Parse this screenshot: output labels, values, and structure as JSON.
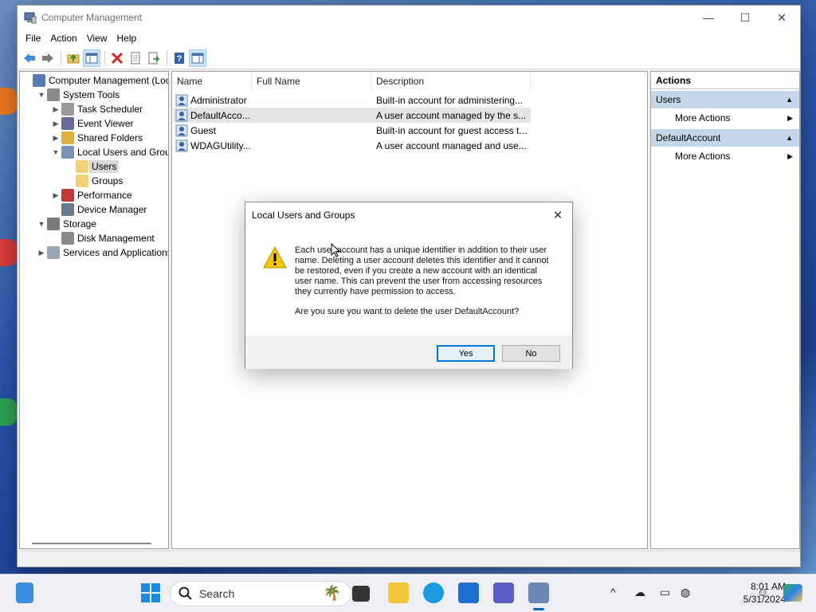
{
  "window": {
    "title": "Computer Management",
    "controls": {
      "minimize": "—",
      "maximize": "☐",
      "close": "✕"
    }
  },
  "menu": [
    "File",
    "Action",
    "View",
    "Help"
  ],
  "tree": [
    {
      "label": "Computer Management (Local",
      "indent": 0,
      "chev": "",
      "icon": "computer-management-icon"
    },
    {
      "label": "System Tools",
      "indent": 1,
      "chev": "⌄",
      "icon": "system-tools-icon"
    },
    {
      "label": "Task Scheduler",
      "indent": 2,
      "chev": "›",
      "icon": "clock-icon"
    },
    {
      "label": "Event Viewer",
      "indent": 2,
      "chev": "›",
      "icon": "event-viewer-icon"
    },
    {
      "label": "Shared Folders",
      "indent": 2,
      "chev": "›",
      "icon": "shared-folder-icon"
    },
    {
      "label": "Local Users and Groups",
      "indent": 2,
      "chev": "⌄",
      "icon": "users-group-icon"
    },
    {
      "label": "Users",
      "indent": 3,
      "chev": "",
      "icon": "folder-icon",
      "selected": true
    },
    {
      "label": "Groups",
      "indent": 3,
      "chev": "",
      "icon": "folder-icon"
    },
    {
      "label": "Performance",
      "indent": 2,
      "chev": "›",
      "icon": "performance-icon"
    },
    {
      "label": "Device Manager",
      "indent": 2,
      "chev": "",
      "icon": "device-manager-icon"
    },
    {
      "label": "Storage",
      "indent": 1,
      "chev": "⌄",
      "icon": "storage-icon"
    },
    {
      "label": "Disk Management",
      "indent": 2,
      "chev": "",
      "icon": "disk-icon"
    },
    {
      "label": "Services and Applications",
      "indent": 1,
      "chev": "›",
      "icon": "services-icon"
    }
  ],
  "list": {
    "columns": [
      "Name",
      "Full Name",
      "Description"
    ],
    "rows": [
      {
        "name": "Administrator",
        "full_name": "",
        "description": "Built-in account for administering..."
      },
      {
        "name": "DefaultAcco...",
        "full_name": "",
        "description": "A user account managed by the s...",
        "selected": true
      },
      {
        "name": "Guest",
        "full_name": "",
        "description": "Built-in account for guest access t..."
      },
      {
        "name": "WDAGUtility...",
        "full_name": "",
        "description": "A user account managed and use..."
      }
    ]
  },
  "actions": {
    "header": "Actions",
    "sections": [
      {
        "title": "Users",
        "items": [
          "More Actions"
        ]
      },
      {
        "title": "DefaultAccount",
        "items": [
          "More Actions"
        ]
      }
    ]
  },
  "dialog": {
    "title": "Local Users and Groups",
    "message": "Each user account has a unique identifier in addition to their user name. Deleting a user account deletes this identifier and it cannot be restored, even if you create a new account with an identical user name. This can prevent the user from accessing resources they currently have permission to access.",
    "question": "Are you sure you want to delete the user DefaultAccount?",
    "yes_label": "Yes",
    "no_label": "No",
    "close_glyph": "✕"
  },
  "taskbar": {
    "search_placeholder": "Search",
    "time": "8:01 AM",
    "date": "5/31/2024",
    "tray_up": "^"
  },
  "colors": {
    "accent": "#0078d7",
    "selection": "#c5d6ea",
    "warning": "#f7c600"
  }
}
